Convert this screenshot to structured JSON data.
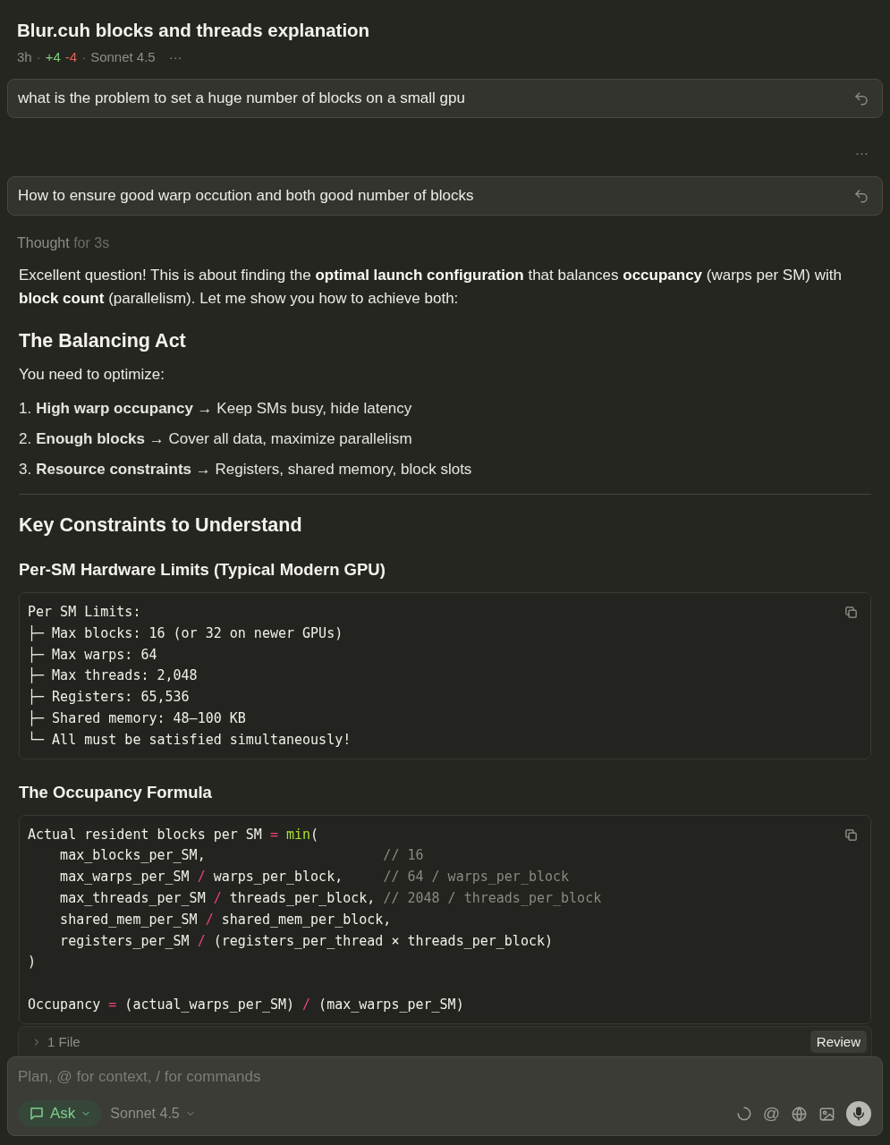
{
  "conversation": {
    "title": "Blur.cuh blocks and threads explanation",
    "meta": {
      "age": "3h",
      "separator_1": "·",
      "added": "+4",
      "removed": "-4",
      "separator_2": "·",
      "model": "Sonnet 4.5",
      "more": "···"
    }
  },
  "messages": [
    {
      "kind": "prompt",
      "text": "what is the problem to set a huge number of blocks on a small gpu"
    },
    {
      "kind": "more",
      "text": "···"
    },
    {
      "kind": "prompt",
      "text": "How to ensure good warp occution and both good number of blocks"
    }
  ],
  "thought": {
    "label": "Thought",
    "duration": "for 3s"
  },
  "answer": [
    {
      "kind": "paragraph",
      "text": "Excellent question! This is about finding the **optimal launch configuration** that balances **occupancy** (warps per SM) with **block count** (parallelism). Let me show you how to achieve both:"
    },
    {
      "kind": "h2",
      "text": "The Balancing Act"
    },
    {
      "kind": "paragraph",
      "text": "You need to optimize:"
    },
    {
      "kind": "list",
      "items": [
        {
          "number": "1.",
          "text": "**High warp occupancy** → Keep SMs busy, hide latency"
        },
        {
          "number": "2.",
          "text": "**Enough blocks** → Cover all data, maximize parallelism"
        },
        {
          "number": "3.",
          "text": "**Resource constraints** → Registers, shared memory, block slots"
        }
      ]
    },
    {
      "kind": "rule"
    },
    {
      "kind": "h2",
      "text": "Key Constraints to Understand"
    },
    {
      "kind": "h3",
      "text": "Per-SM Hardware Limits (Typical Modern GPU)"
    },
    {
      "kind": "code",
      "lines": [
        [
          {
            "kind": "plain",
            "text": "Per SM Limits:"
          }
        ],
        [
          {
            "kind": "plain",
            "text": "├─ Max blocks: 16 (or 32 on newer GPUs)"
          }
        ],
        [
          {
            "kind": "plain",
            "text": "├─ Max warps: 64"
          }
        ],
        [
          {
            "kind": "plain",
            "text": "├─ Max threads: 2,048"
          }
        ],
        [
          {
            "kind": "plain",
            "text": "├─ Registers: 65,536"
          }
        ],
        [
          {
            "kind": "plain",
            "text": "├─ Shared memory: 48–100 KB"
          }
        ],
        [
          {
            "kind": "plain",
            "text": "└─ All must be satisfied simultaneously!"
          }
        ]
      ]
    },
    {
      "kind": "h3",
      "text": "The Occupancy Formula"
    },
    {
      "kind": "code",
      "lines": [
        [
          {
            "kind": "plain",
            "text": "Actual resident blocks per SM "
          },
          {
            "kind": "operator",
            "text": "= "
          },
          {
            "kind": "function",
            "text": "min"
          },
          {
            "kind": "plain",
            "text": "("
          }
        ],
        [
          {
            "kind": "plain",
            "text": "    max_blocks_per_SM,                      "
          },
          {
            "kind": "comment",
            "text": "// 16"
          }
        ],
        [
          {
            "kind": "plain",
            "text": "    max_warps_per_SM "
          },
          {
            "kind": "operator",
            "text": "/"
          },
          {
            "kind": "plain",
            "text": " warps_per_block,     "
          },
          {
            "kind": "comment",
            "text": "// 64 / warps_per_block"
          }
        ],
        [
          {
            "kind": "plain",
            "text": "    max_threads_per_SM "
          },
          {
            "kind": "operator",
            "text": "/"
          },
          {
            "kind": "plain",
            "text": " threads_per_block, "
          },
          {
            "kind": "comment",
            "text": "// 2048 / threads_per_block"
          }
        ],
        [
          {
            "kind": "plain",
            "text": "    shared_mem_per_SM "
          },
          {
            "kind": "operator",
            "text": "/"
          },
          {
            "kind": "plain",
            "text": " shared_mem_per_block,"
          }
        ],
        [
          {
            "kind": "plain",
            "text": "    registers_per_SM "
          },
          {
            "kind": "operator",
            "text": "/"
          },
          {
            "kind": "plain",
            "text": " (registers_per_thread × threads_per_block)"
          }
        ],
        [
          {
            "kind": "plain",
            "text": ")"
          }
        ],
        {
          "kind": "blank"
        },
        [
          {
            "kind": "plain",
            "text": "Occupancy "
          },
          {
            "kind": "operator",
            "text": "="
          },
          {
            "kind": "plain",
            "text": " (actual_warps_per_SM) "
          },
          {
            "kind": "operator",
            "text": "/"
          },
          {
            "kind": "plain",
            "text": " (max_warps_per_SM)"
          }
        ]
      ]
    }
  ],
  "files_bar": {
    "label": "1 File",
    "action": "Review"
  },
  "composer": {
    "placeholder": "Plan, @ for context, / for commands",
    "mode": "Ask",
    "model": "Sonnet 4.5",
    "mention": "@"
  }
}
